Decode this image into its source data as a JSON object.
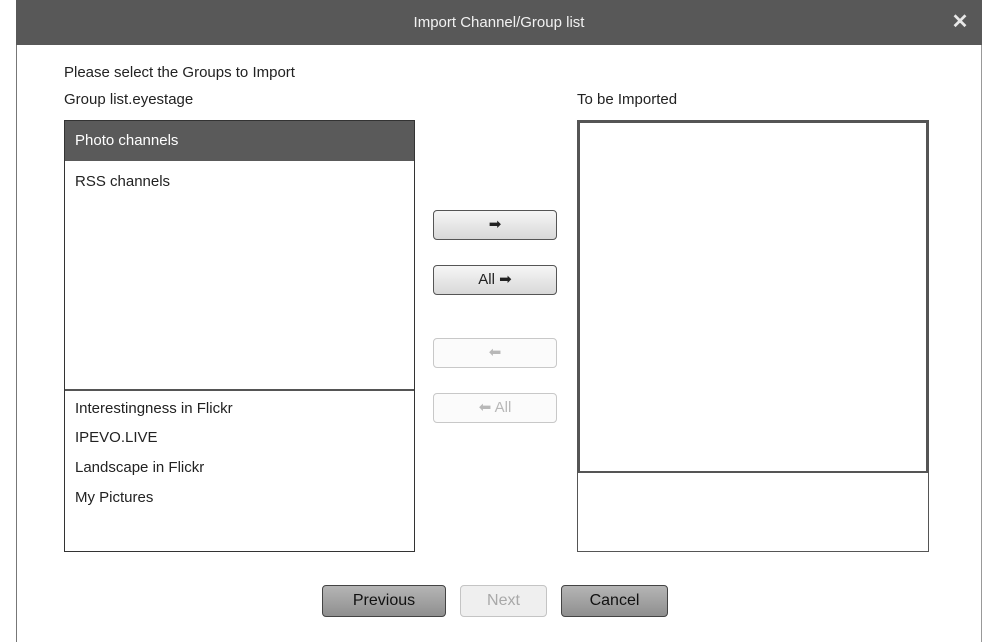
{
  "window": {
    "title": "Import Channel/Group list",
    "close_glyph": "✕",
    "close_icon": "close-icon"
  },
  "instructions": {
    "select_text": "Please select the Groups to Import",
    "source_label": "Group list.eyestage",
    "target_label": "To be Imported"
  },
  "source": {
    "header": "Photo channels",
    "upper_items": [
      "RSS channels"
    ],
    "lower_items": [
      "Interestingness in Flickr",
      "IPEVO.LIVE",
      "Landscape in Flickr",
      "My Pictures"
    ]
  },
  "transfer": {
    "add": "➡",
    "add_all": "All ➡",
    "remove": "⬅",
    "remove_all": "⬅ All"
  },
  "footer": {
    "previous": "Previous",
    "next": "Next",
    "cancel": "Cancel"
  }
}
